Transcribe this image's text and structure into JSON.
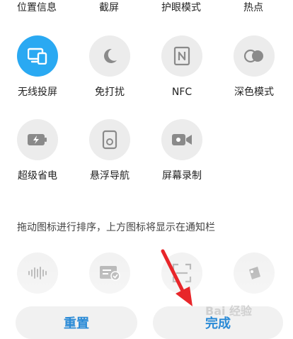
{
  "top_row_labels": [
    "位置信息",
    "截屏",
    "护眼模式",
    "热点"
  ],
  "tiles_row1": [
    {
      "label": "无线投屏",
      "icon": "cast-screen-icon",
      "active": true
    },
    {
      "label": "免打扰",
      "icon": "moon-icon",
      "active": false
    },
    {
      "label": "NFC",
      "icon": "nfc-icon",
      "active": false
    },
    {
      "label": "深色模式",
      "icon": "dark-mode-icon",
      "active": false
    }
  ],
  "tiles_row2": [
    {
      "label": "超级省电",
      "icon": "battery-saver-icon"
    },
    {
      "label": "悬浮导航",
      "icon": "floating-nav-icon"
    },
    {
      "label": "屏幕录制",
      "icon": "screen-record-icon"
    }
  ],
  "hint": "拖动图标进行排序，上方图标将显示在通知栏",
  "tiles_row3_icons": [
    "audio-wave-icon",
    "card-check-icon",
    "scan-icon",
    "tag-icon"
  ],
  "buttons": {
    "reset": "重置",
    "done": "完成"
  },
  "colors": {
    "accent": "#2aa9f2",
    "button_text": "#2a8ad6",
    "annotation_arrow": "#e8262a"
  },
  "watermark": "Bai 经验"
}
